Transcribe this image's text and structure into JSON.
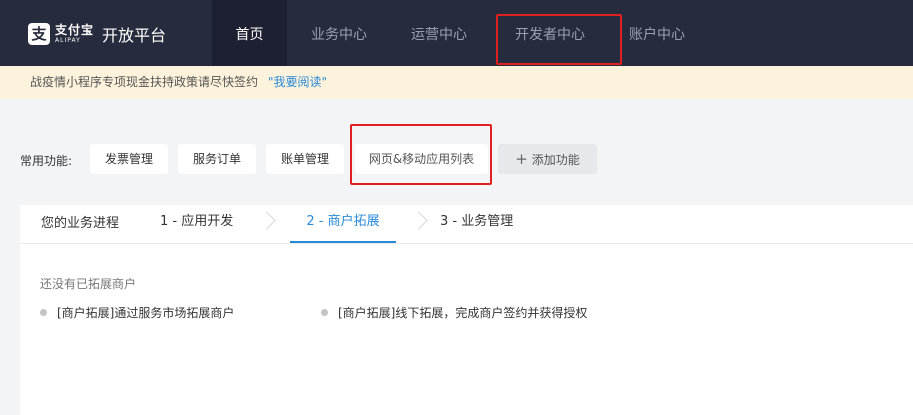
{
  "brand": {
    "logo_mark": "支",
    "logo_cn": "支付宝",
    "logo_en": "ALIPAY",
    "platform": "开放平台"
  },
  "nav": {
    "home": "首页",
    "business": "业务中心",
    "operations": "运营中心",
    "developer": "开发者中心",
    "account": "账户中心"
  },
  "notice": {
    "text": "战疫情小程序专项现金扶持政策请尽快签约",
    "link": "\"我要阅读\""
  },
  "quick": {
    "label": "常用功能:",
    "invoice": "发票管理",
    "service_order": "服务订单",
    "bill": "账单管理",
    "web_mobile_apps": "网页&移动应用列表",
    "add_icon": "+",
    "add": "添加功能"
  },
  "progress": {
    "title": "您的业务进程",
    "step1": "1 - 应用开发",
    "step2": "2 - 商户拓展",
    "step3": "3 - 业务管理",
    "empty_title": "还没有已拓展商户",
    "task1": "[商户拓展]通过服务市场拓展商户",
    "task2": "[商户拓展]线下拓展，完成商户签约并获得授权"
  },
  "colors": {
    "nav_bg": "#262b3d",
    "accent": "#2a8ad8",
    "highlight_box": "#e02020",
    "notice_bg": "#fdf3dc"
  },
  "icons": {
    "logo": "alipay-logo-icon",
    "add": "plus-icon",
    "chevron": "chevron-right-icon",
    "bullet": "dot-icon"
  }
}
